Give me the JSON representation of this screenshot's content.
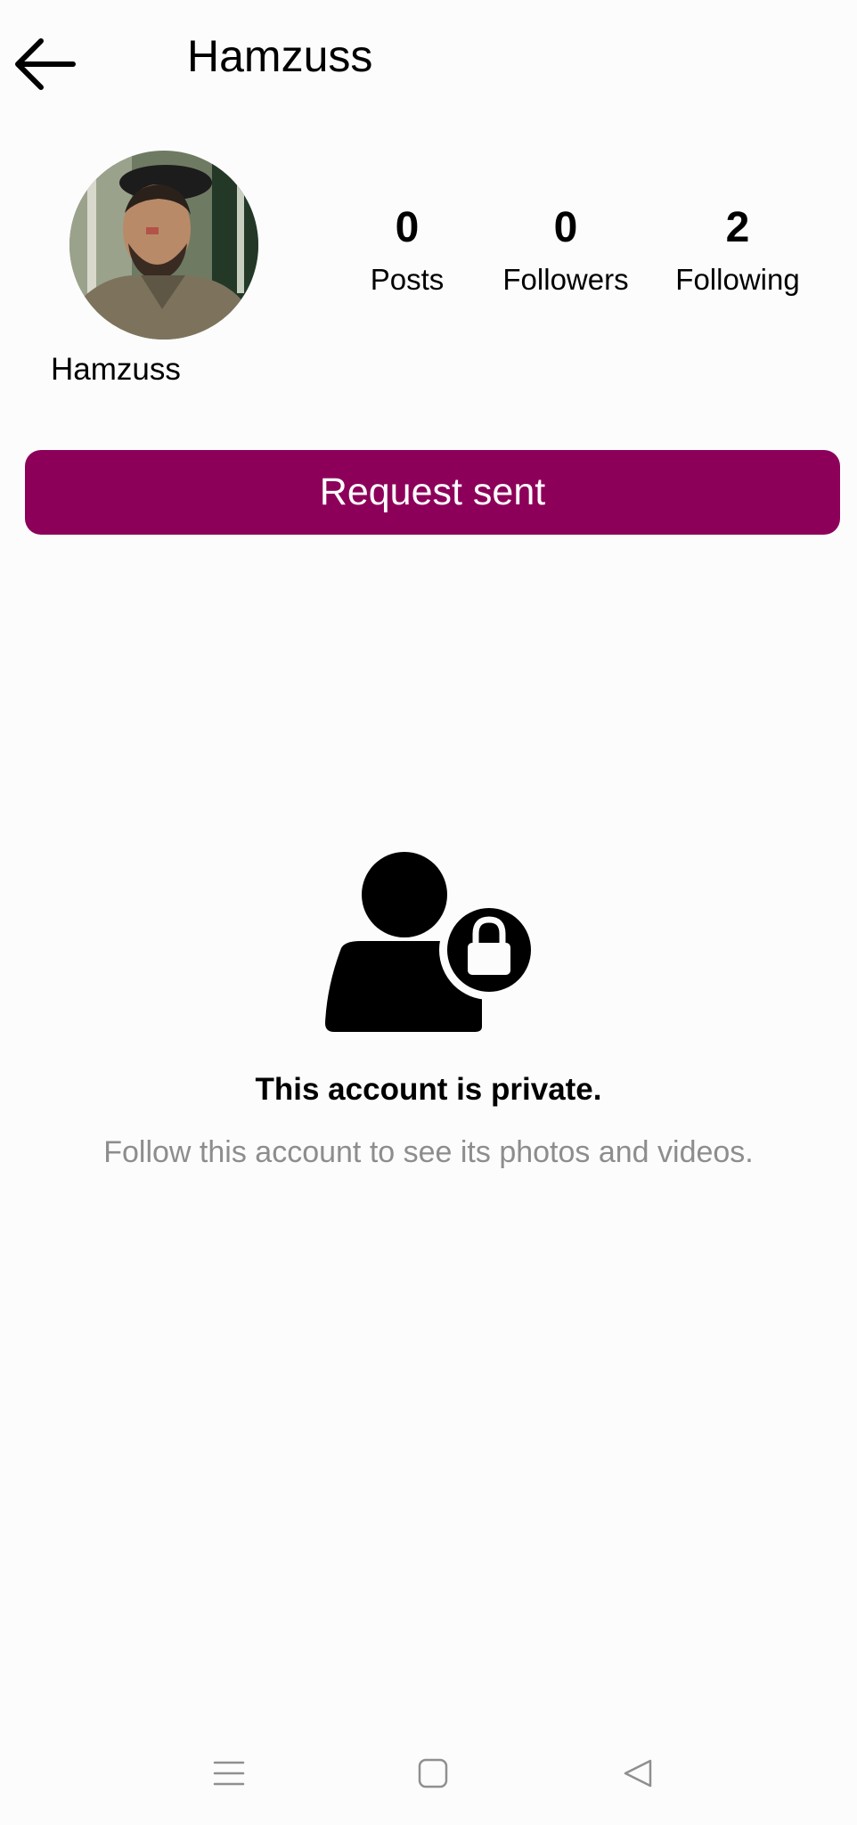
{
  "header": {
    "title": "Hamzuss",
    "back_icon": "arrow-left-icon"
  },
  "profile": {
    "username": "Hamzuss",
    "avatar": "profile-photo",
    "stats": [
      {
        "value": "0",
        "label": "Posts"
      },
      {
        "value": "0",
        "label": "Followers"
      },
      {
        "value": "2",
        "label": "Following"
      }
    ]
  },
  "actions": {
    "request_label": "Request sent",
    "accent_color": "#8c005a"
  },
  "private_notice": {
    "icon": "private-account-lock-icon",
    "title": "This account is private.",
    "subtitle": "Follow this account to see its photos and videos."
  },
  "system_nav": {
    "items": [
      "menu-icon",
      "home-square-icon",
      "back-triangle-icon"
    ]
  }
}
